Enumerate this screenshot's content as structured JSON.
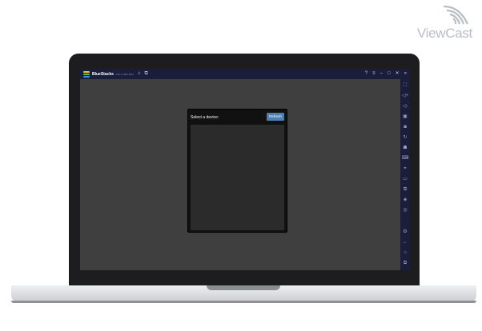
{
  "logo": {
    "text": "ViewCast",
    "icon": "wifi-signal-icon"
  },
  "emulator": {
    "title": "BlueStacks",
    "version": "4.60.1.1002 Beta",
    "titlebar_icons": [
      "home-icon",
      "multi-instance-icon"
    ],
    "window_controls": {
      "help": "?",
      "menu": "≡",
      "minimize": "–",
      "maximize": "□",
      "close": "✕",
      "collapse": "«"
    },
    "sidebar_icons": [
      "fullscreen-icon",
      "volume-up-icon",
      "volume-down-icon",
      "video-icon",
      "screenshot-icon",
      "rotate-icon",
      "shake-icon",
      "keyboard-icon",
      "location-icon",
      "folder-icon",
      "copy-icon",
      "layers-icon",
      "settings-alt-icon",
      "gear-icon",
      "back-icon",
      "home-icon",
      "recent-apps-icon"
    ],
    "colors": {
      "titlebar": "#1b1e3a",
      "screen": "#3f3f3f",
      "refresh": "#4f7fb0"
    }
  },
  "dialog": {
    "title": "Select a device:",
    "refresh_label": "Refresh"
  }
}
